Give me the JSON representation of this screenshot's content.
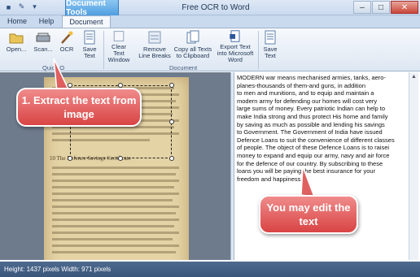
{
  "window": {
    "title": "Free OCR to Word",
    "context_tab": "Document Tools",
    "minimize_glyph": "–",
    "maximize_glyph": "□",
    "close_glyph": "✕"
  },
  "quick_access": [
    "save-icon",
    "tools-icon",
    "down-arrow-icon"
  ],
  "tabs": [
    {
      "label": "Home"
    },
    {
      "label": "Help"
    },
    {
      "label": "Document"
    }
  ],
  "ribbon": {
    "buttons": [
      {
        "label": "Open...",
        "icon": "open-folder-icon"
      },
      {
        "label": "Scan...",
        "icon": "scanner-icon"
      },
      {
        "label": "OCR",
        "icon": "ocr-wand-icon"
      },
      {
        "label": "Save Text",
        "icon": "save-text-icon"
      },
      {
        "label": "Clear Text Window",
        "icon": "clear-window-icon"
      },
      {
        "label": "Remove Line Breaks",
        "icon": "remove-line-breaks-icon"
      },
      {
        "label": "Copy all Texts to Clipboard",
        "icon": "copy-clipboard-icon"
      },
      {
        "label": "Export Text into Microsoft Word",
        "icon": "export-word-icon"
      },
      {
        "label": "Save Text",
        "icon": "save-text-icon"
      }
    ],
    "groups": [
      "Quick O",
      "Document"
    ]
  },
  "document_image": {
    "heading": "10 The Defence Savings Certificate"
  },
  "ocr_text": "MODERN war means mechanised armies, tanks, aero-\nplanes-thousands of them-and guns, in addition\nto men and munitions, and to equip and maintain a\nmodern army for defending our homes will cost very\nlarge sums of money. Every patriotic Indian can help to\nmake India strong and thus protect His home and family\nby saving as much as possible and lending his savings\nto Government. The Government of India have issued\nDefence Loans to suit the convenience of different classes\nof people. The object of these Defence Loans is to raisei\nmoney to expand and equip our army, navy and air force\nfor the defence of our country. By subscribing to these\nloans you will be paying the best insurance for your\nfreedom and happiness.",
  "callouts": {
    "extract": "1. Extract the text from image",
    "edit": "You may edit the text"
  },
  "status": {
    "text": "Height: 1437 pixels  Width: 971 pixels"
  },
  "colors": {
    "callout": "#d94444",
    "context_tab": "#4f9ee0",
    "status_bar": "#3a557a"
  }
}
